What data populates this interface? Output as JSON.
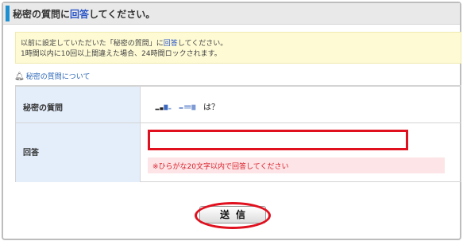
{
  "header": {
    "title_pre": "秘密の質問に",
    "title_hl": "回答",
    "title_post": "してください。"
  },
  "notice": {
    "line1_pre": "以前に設定していただいた「秘密の質問」に",
    "line1_hl": "回答",
    "line1_post": "してください。",
    "line2": "1時間以内に10回以上間違えた場合、24時間ロックされます。"
  },
  "help_link": "秘密の質問について",
  "form": {
    "question_label": "秘密の質問",
    "question_suffix": "は？",
    "answer_label": "回答",
    "answer_value": "",
    "hint": "※ひらがな20文字以内で回答してください"
  },
  "submit_label": "送信",
  "colors": {
    "accent_bar": "#1e8fd0",
    "highlight_text": "#2a55c8",
    "error_red": "#e0101e",
    "label_bg": "#e4eefb",
    "notice_bg": "#fdfad4"
  },
  "icons": {
    "help": "bell-icon"
  }
}
